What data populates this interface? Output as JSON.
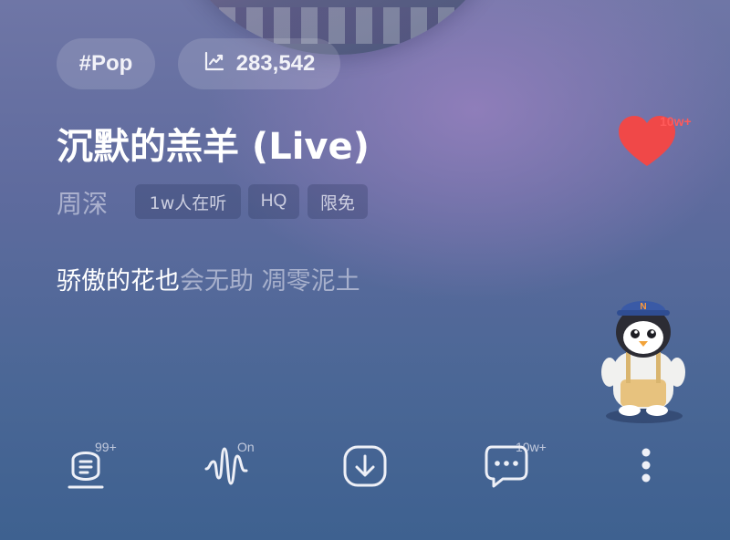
{
  "song": {
    "genre_tag": "#Pop",
    "play_count": "283,542",
    "title": "沉默的羔羊 (Live)",
    "artist": "周深",
    "badges": [
      "1w人在听",
      "HQ",
      "限免"
    ],
    "lyric_sung": "骄傲的花也",
    "lyric_unsung": "会无助 凋零泥土"
  },
  "like": {
    "count": "10w+",
    "icon": "heart-icon",
    "color": "#f04848"
  },
  "toolbar": {
    "comments_badge": "99+",
    "sound_effect_state": "On",
    "share_count": "10w+",
    "icons": [
      "lyrics-icon",
      "sound-effect-icon",
      "download-icon",
      "chat-icon",
      "more-icon"
    ]
  },
  "colors": {
    "accent_red": "#f04848",
    "background_top": "#6f76a6",
    "background_bottom": "#3e6190"
  }
}
